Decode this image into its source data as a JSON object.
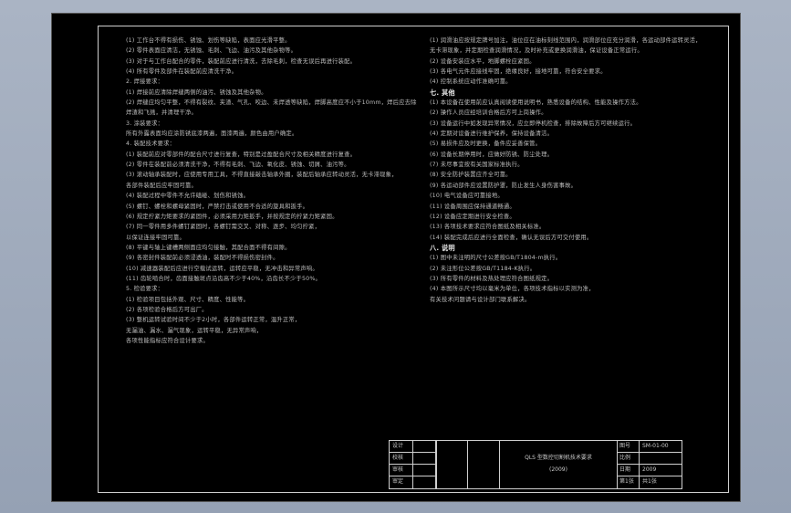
{
  "notes_left": [
    "(1) 工作台不得有损伤、锈蚀、划伤等缺陷，表面应光滑平整。",
    "(2) 零件表面应清洁，无锈蚀、毛刺、飞边、油污及其他杂物等。",
    "(3) 对于与工作台配合的零件，装配前应进行清洗，去除毛刺，检查无误后再进行装配。",
    "(4) 所有零件及部件在装配前应清洗干净。",
    "2. 焊接要求：",
    "(1) 焊接前应清除焊缝两侧的油污、锈蚀及其他杂物。",
    "(2) 焊缝应均匀平整，不得有裂纹、夹渣、气孔、咬边、未焊透等缺陷，焊脚高度应不小于10mm，焊后应去除",
    "焊渣和飞溅，并清理干净。",
    "3. 涂装要求：",
    "  所有外露表面均应涂防锈底漆两遍，面漆两遍，颜色由用户确定。",
    "4. 装配技术要求：",
    "(1) 装配前应对零部件的配合尺寸进行复查，特别是过盈配合尺寸及相关精度进行复查。",
    "(2) 零件在装配前必须清洗干净，不得有毛刺、飞边、氧化皮、锈蚀、切屑、油污等。",
    "(3) 滚动轴承装配时，应使用专用工具，不得直接敲击轴承外圈，装配后轴承应转动灵活，无卡滞现象，",
    "各部件装配后应牢固可靠。",
    "(4) 装配过程中零件不允许磕碰、划伤和锈蚀。",
    "(5) 螺钉、螺栓和螺母紧固时，严禁打击或使用不合适的旋具和扳手。",
    "(6) 规定拧紧力矩要求的紧固件，必须采用力矩扳手，并按规定的拧紧力矩紧固。",
    "(7) 同一零件用多件螺钉紧固时，各螺钉需交叉、对称、逐步、均匀拧紧，",
    "以保证连接牢固可靠。",
    "(8) 平键与轴上键槽两侧面应均匀接触，其配合面不得有间隙。",
    "(9) 各密封件装配前必须浸透油，装配时不得损伤密封件。",
    "(10) 减速器装配后应进行空载试运转，运转应平稳，无冲击和异常声响。",
    "(11) 齿轮啮合时，齿面接触斑点沿齿高不少于40%，沿齿长不少于50%。",
    "5. 检验要求：",
    "(1) 检验项目包括外观、尺寸、精度、性能等。",
    "(2) 各项检验合格后方可出厂。",
    "(3) 整机运转试验时间不少于2小时，各部件运转正常，温升正常，",
    "无漏油、漏水、漏气现象，运转平稳，无异常声响，",
    "各项性能指标应符合设计要求。"
  ],
  "notes_right": [
    "(1) 润滑油应按规定牌号加注，油位应在油标刻线范围内，润滑部位应充分润滑，各运动部件运转灵活，",
    "无卡滞现象，并定期检查润滑情况，及时补充或更换润滑油，保证设备正常运行。",
    "(2) 设备安装应水平，地脚螺栓应紧固。",
    "(3) 各电气元件应接线牢固，绝缘良好，接地可靠，符合安全要求。",
    "(4) 控制系统应动作准确可靠。",
    "七. 其他",
    "(1) 本设备在使用前应认真阅读使用说明书，熟悉设备的结构、性能及操作方法。",
    "(2) 操作人员应经培训合格后方可上岗操作。",
    "(3) 设备运行中如发现异常情况，应立即停机检查，排除故障后方可继续运行。",
    "(4) 定期对设备进行维护保养，保持设备清洁。",
    "(5) 易损件应及时更换，备件应妥善保管。",
    "(6) 设备长期停用时，应做好防锈、防尘处理。",
    "(7) 未尽事宜按有关国家标准执行。",
    "(8) 安全防护装置应齐全可靠。",
    "(9) 各运动部件应设置防护罩，防止发生人身伤害事故。",
    "(10) 电气设备应可靠接地。",
    "(11) 设备周围应保持通道畅通。",
    "(12) 设备应定期进行安全检查。",
    "(13) 各项技术要求应符合图纸及相关标准。",
    "(14) 装配完成后应进行全面检查，确认无误后方可交付使用。",
    "八. 说明",
    "(1) 图中未注明的尺寸公差按GB/T1804-m执行。",
    "(2) 未注形位公差按GB/T1184-K执行。",
    "(3) 所有零件的材料及热处理应符合图纸规定。",
    "(4) 本图所示尺寸均以毫米为单位，各项技术指标以实测为准，",
    "有关技术问题请与设计部门联系解决。"
  ],
  "title_block": {
    "left_rows": [
      {
        "a": "设计",
        "b": ""
      },
      {
        "a": "校核",
        "b": ""
      },
      {
        "a": "审核",
        "b": ""
      },
      {
        "a": "审定",
        "b": ""
      }
    ],
    "title_line1": "QLS 型数控切割机技术要求",
    "title_line2": "(2009)",
    "right_rows": [
      {
        "label": "图号",
        "value": "SM-01-00"
      },
      {
        "label": "比例",
        "value": ""
      },
      {
        "label": "日期",
        "value": "2009"
      },
      {
        "label": "第1张",
        "value": "共1张"
      }
    ]
  }
}
